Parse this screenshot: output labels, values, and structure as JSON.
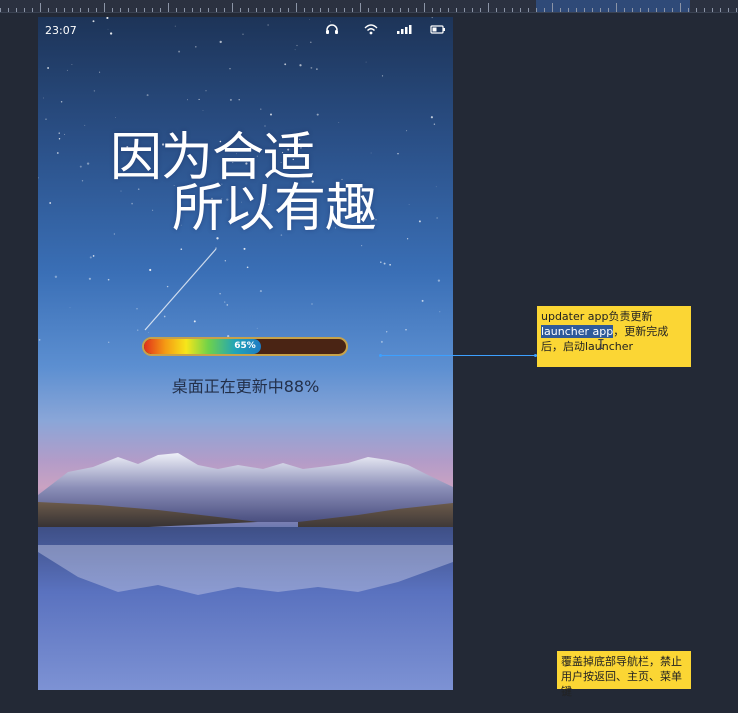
{
  "status_bar": {
    "time": "23:07",
    "icons": [
      "headset-icon",
      "wifi-icon",
      "signal-icon",
      "battery-icon"
    ]
  },
  "splash": {
    "slogan_line1": "因为合适",
    "slogan_line2": "所以有趣"
  },
  "progress": {
    "percent_label": "65%",
    "fill_fraction": 0.58,
    "status_text": "桌面正在更新中88%"
  },
  "annotations": {
    "note1": {
      "text_before": "updater app负责更新",
      "highlighted": "launcher app",
      "text_after": "，更新完成后，启动launcher"
    },
    "note2": {
      "text": "覆盖掉底部导航栏，禁止用户按返回、主页、菜单键"
    }
  },
  "colors": {
    "annotation_bg": "#fbd634",
    "connector": "#3da0ff",
    "progress_border": "#c7a24a"
  }
}
